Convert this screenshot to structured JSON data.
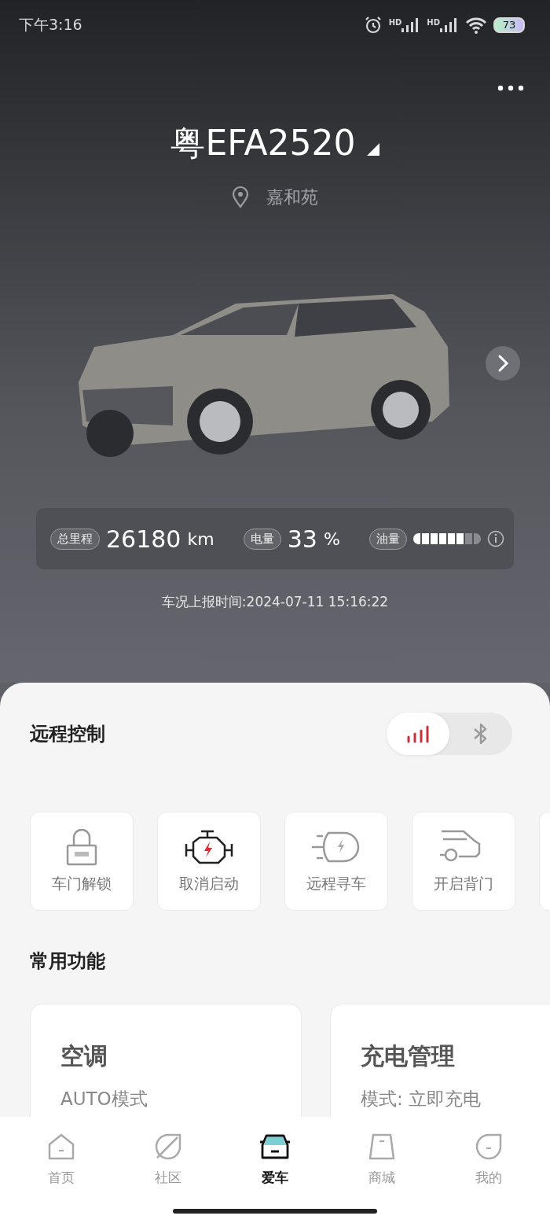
{
  "status_bar": {
    "time": "下午3:16",
    "signals": [
      {
        "label": "HD"
      },
      {
        "label": "HD"
      }
    ],
    "battery": "73"
  },
  "vehicle": {
    "plate": "粤EFA2520",
    "location": "嘉和苑"
  },
  "stats": [
    {
      "kind": "value",
      "label": "总里程",
      "value": "26180",
      "unit": "km"
    },
    {
      "kind": "value",
      "label": "电量",
      "value": "33",
      "unit": "%"
    },
    {
      "kind": "gauge",
      "label": "油量",
      "level": 0.75
    }
  ],
  "report_time": "车况上报时间:2024-07-11 15:16:22",
  "remote": {
    "title": "远程控制",
    "modes": [
      {
        "kind": "network",
        "selected": true
      },
      {
        "kind": "bluetooth",
        "selected": false
      }
    ],
    "actions": [
      {
        "kind": "lock",
        "label": "车门解锁"
      },
      {
        "kind": "engine",
        "label": "取消启动"
      },
      {
        "kind": "lamp",
        "label": "远程寻车"
      },
      {
        "kind": "tailgate",
        "label": "开启背门"
      }
    ]
  },
  "common": {
    "title": "常用功能",
    "cards": [
      {
        "title": "空调",
        "subtitle": "AUTO模式"
      },
      {
        "title": "充电管理",
        "subtitle": "模式: 立即充电"
      }
    ]
  },
  "nav": [
    {
      "kind": "home",
      "label": "首页",
      "selected": false
    },
    {
      "kind": "community",
      "label": "社区",
      "selected": false
    },
    {
      "kind": "car",
      "label": "爱车",
      "selected": true
    },
    {
      "kind": "mall",
      "label": "商城",
      "selected": false
    },
    {
      "kind": "mine",
      "label": "我的",
      "selected": false
    }
  ]
}
